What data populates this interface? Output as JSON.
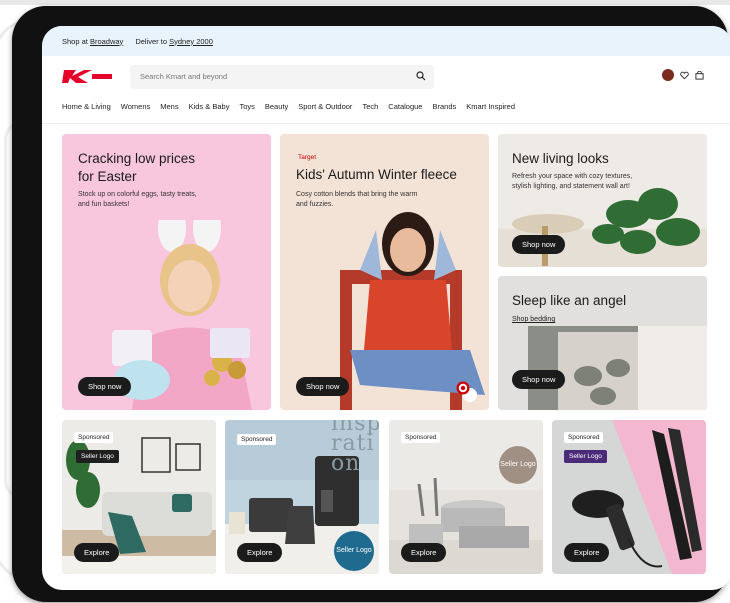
{
  "utility": {
    "shop_prefix": "Shop at",
    "store": "Broadway",
    "deliver_prefix": "Deliver to",
    "suburb": "Sydney 2000"
  },
  "search": {
    "placeholder": "Search Kmart and beyond"
  },
  "nav": [
    "Home & Living",
    "Womens",
    "Mens",
    "Kids & Baby",
    "Toys",
    "Beauty",
    "Sport & Outdoor",
    "Tech",
    "Catalogue",
    "Brands",
    "Kmart Inspired"
  ],
  "hero": {
    "easter": {
      "title_line1": "Cracking low prices",
      "title_line2": "for Easter",
      "desc_line1": "Stock up on colorful eggs, tasty treats,",
      "desc_line2": "and fun baskets!",
      "cta": "Shop now"
    },
    "fleece": {
      "brand": "Target",
      "title": "Kids' Autumn Winter fleece",
      "desc_line1": "Cosy cotton blends that bring the warm",
      "desc_line2": "and fuzzies.",
      "cta": "Shop now"
    },
    "living": {
      "title": "New living looks",
      "desc_line1": "Refresh your space with cozy textures,",
      "desc_line2": "stylish lighting, and statement wall art!",
      "cta": "Shop now"
    },
    "sleep": {
      "title": "Sleep like an angel",
      "link": "Shop bedding",
      "cta": "Shop now"
    }
  },
  "sponsored": [
    {
      "tag": "Sponsored",
      "seller": "Seller Logo",
      "cta": "Explore"
    },
    {
      "tag": "Sponsored",
      "seller": "Seller Logo",
      "cta": "Explore",
      "overlay": "inspi rati on"
    },
    {
      "tag": "Sponsored",
      "seller": "Seller Logo",
      "cta": "Explore"
    },
    {
      "tag": "Sponsored",
      "seller": "Seller Logo",
      "cta": "Explore"
    }
  ],
  "colors": {
    "brand_red": "#e4002b",
    "pink": "#f8c6dd",
    "seller_blue": "#1f6b8f",
    "seller_purple": "#4b2a7a",
    "seller_taupe": "#a08f83"
  }
}
